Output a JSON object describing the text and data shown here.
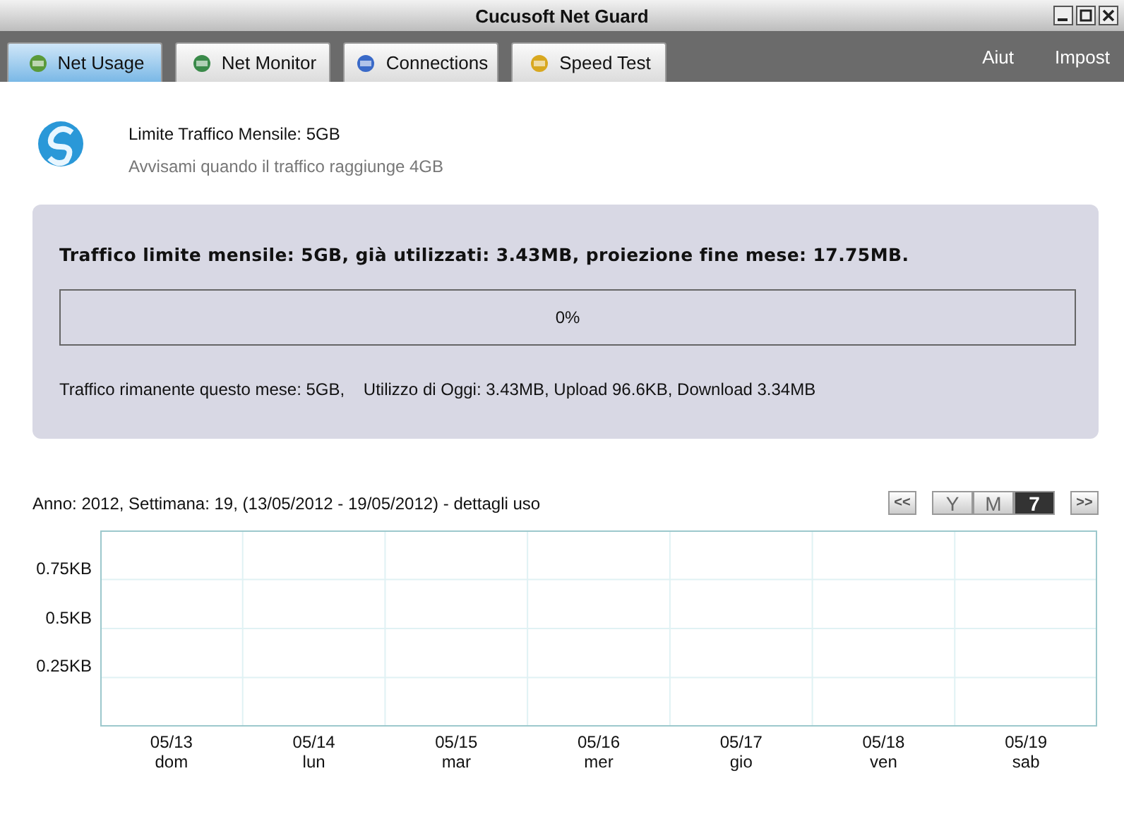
{
  "window": {
    "title": "Cucusoft Net Guard"
  },
  "tabs": [
    {
      "label": "Net Usage",
      "selected": true,
      "kind": "usage"
    },
    {
      "label": "Net Monitor",
      "selected": false,
      "kind": "monitor"
    },
    {
      "label": "Connections",
      "selected": false,
      "kind": "connections"
    },
    {
      "label": "Speed Test",
      "selected": false,
      "kind": "speed"
    }
  ],
  "menu_links": [
    "Aiut",
    "Impost"
  ],
  "header": {
    "limit": "Limite Traffico Mensile: 5GB",
    "alert": "Avvisami quando il traffico raggiunge 4GB"
  },
  "summary": {
    "headline": "Traffico limite mensile: 5GB, già utilizzati: 3.43MB, proiezione fine mese: 17.75MB.",
    "level": 0,
    "reading": "0%",
    "details": "Traffico rimanente questo mese: 5GB,    Utilizzo di Oggi: 3.43MB, Upload 96.6KB, Download 3.34MB"
  },
  "chart": {
    "caption": "Anno: 2012, Settimana: 19, (13/05/2012 - 19/05/2012) - dettagli uso",
    "prev": "<<",
    "next": ">>",
    "periods": [
      {
        "label": "Y",
        "selected": false
      },
      {
        "label": "M",
        "selected": false
      },
      {
        "label": "7",
        "selected": true
      }
    ],
    "days": [
      "dom",
      "lun",
      "mar",
      "mer",
      "gio",
      "ven",
      "sab"
    ],
    "chart_data": {
      "type": "line",
      "grid": true,
      "categories": [
        "05/13",
        "05/14",
        "05/15",
        "05/16",
        "05/17",
        "05/18",
        "05/19"
      ],
      "ylim": [
        0,
        1
      ],
      "yticks": [
        {
          "value": 0.25,
          "label": "0.25KB"
        },
        {
          "value": 0.5,
          "label": "0.5KB"
        },
        {
          "value": 0.75,
          "label": "0.75KB"
        }
      ]
    }
  }
}
